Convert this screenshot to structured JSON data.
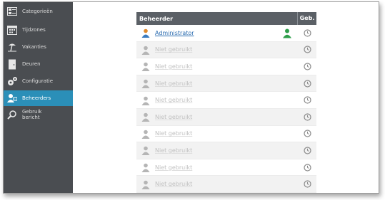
{
  "sidebar": {
    "items": [
      {
        "label": "Categorieën",
        "icon": "categories-icon",
        "active": false
      },
      {
        "label": "Tijdzones",
        "icon": "calendar-icon",
        "active": false
      },
      {
        "label": "Vakanties",
        "icon": "beach-icon",
        "active": false
      },
      {
        "label": "Deuren",
        "icon": "door-icon",
        "active": false
      },
      {
        "label": "Configuratie",
        "icon": "gears-icon",
        "active": false
      },
      {
        "label": "Beheerders",
        "icon": "admin-user-icon",
        "active": true
      },
      {
        "label": "Gebruik\nbericht",
        "icon": "search-icon",
        "active": false
      }
    ]
  },
  "table": {
    "header_name": "Beheerder",
    "header_geb": "Geb.",
    "rows": [
      {
        "name": "Administrator",
        "in_use": true
      },
      {
        "name": "Niet gebruikt",
        "in_use": false
      },
      {
        "name": "Niet gebruikt",
        "in_use": false
      },
      {
        "name": "Niet gebruikt",
        "in_use": false
      },
      {
        "name": "Niet gebruikt",
        "in_use": false
      },
      {
        "name": "Niet gebruikt",
        "in_use": false
      },
      {
        "name": "Niet gebruikt",
        "in_use": false
      },
      {
        "name": "Niet gebruikt",
        "in_use": false
      },
      {
        "name": "Niet gebruikt",
        "in_use": false
      },
      {
        "name": "Niet gebruikt",
        "in_use": false
      }
    ]
  },
  "colors": {
    "sidebar_bg": "#4a4d51",
    "active_bg": "#2b8fb8",
    "header_bg": "#5b6066",
    "link": "#2b6cb0",
    "admin_green": "#2e9e4a"
  }
}
